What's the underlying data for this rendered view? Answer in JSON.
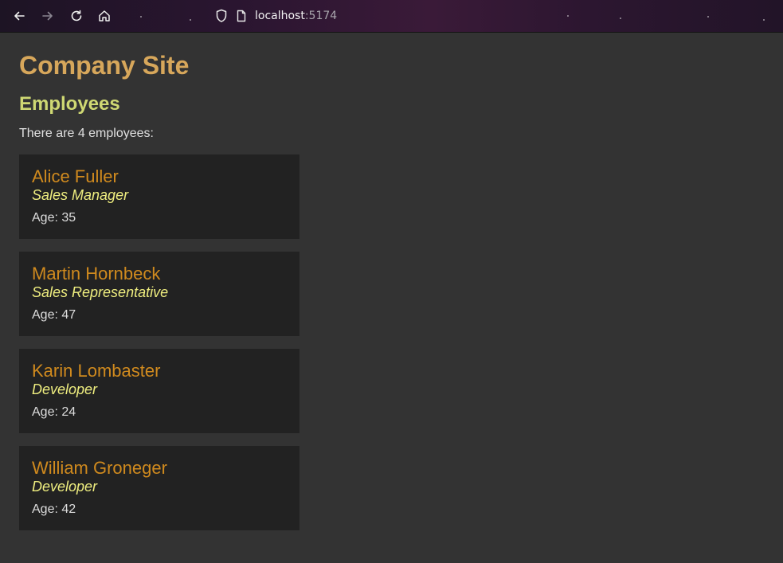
{
  "browser": {
    "url_host": "localhost",
    "url_port": ":5174"
  },
  "page": {
    "site_title": "Company Site",
    "section_title": "Employees",
    "count_text": "There are 4 employees:"
  },
  "employees": [
    {
      "name": "Alice Fuller",
      "title": "Sales Manager",
      "age_text": "Age: 35"
    },
    {
      "name": "Martin Hornbeck",
      "title": "Sales Representative",
      "age_text": "Age: 47"
    },
    {
      "name": "Karin Lombaster",
      "title": "Developer",
      "age_text": "Age: 24"
    },
    {
      "name": "William Groneger",
      "title": "Developer",
      "age_text": "Age: 42"
    }
  ],
  "colors": {
    "site_title": "#d7a75b",
    "section_title": "#cfd873",
    "employee_name": "#d08a1e",
    "employee_title": "#eeed7f",
    "card_bg": "#222222",
    "page_bg": "#333333"
  }
}
